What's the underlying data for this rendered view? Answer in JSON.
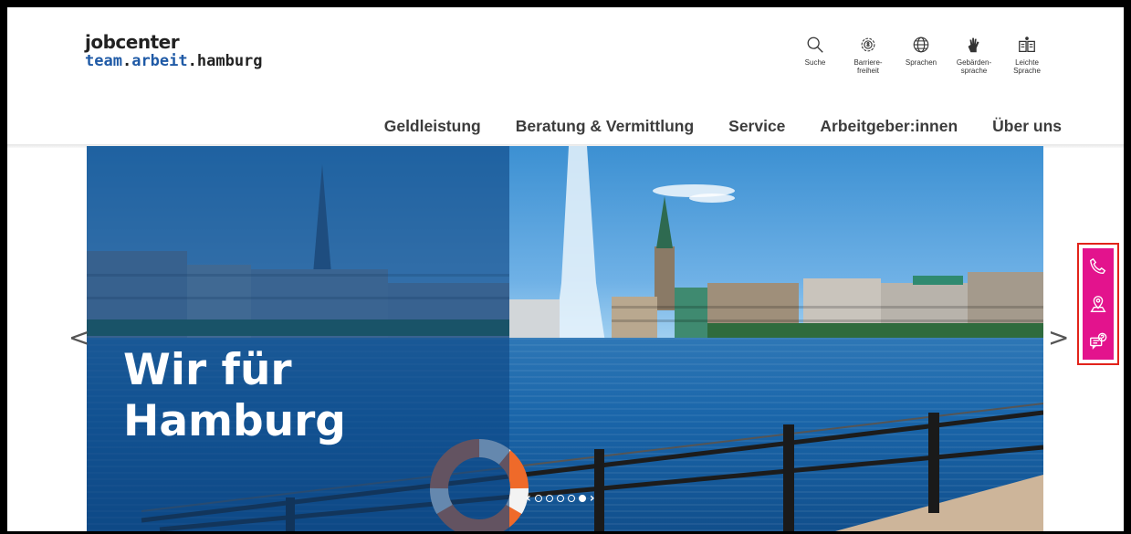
{
  "logo": {
    "line1": "jobcenter",
    "team": "team",
    "dot1": ".",
    "arbeit": "arbeit",
    "dot2": ".",
    "hamburg": "hamburg"
  },
  "tools": [
    {
      "icon": "search-icon",
      "label": "Suche"
    },
    {
      "icon": "accessibility-gear-icon",
      "label": "Barriere-\nfreiheit"
    },
    {
      "icon": "globe-icon",
      "label": "Sprachen"
    },
    {
      "icon": "sign-language-hand-icon",
      "label": "Gebärden-\nsprache"
    },
    {
      "icon": "easy-language-book-icon",
      "label": "Leichte\nSprache"
    }
  ],
  "nav": [
    "Geldleistung",
    "Beratung & Vermittlung",
    "Service",
    "Arbeitgeber:innen",
    "Über uns"
  ],
  "hero": {
    "line1": "Wir für",
    "line2": "Hamburg",
    "slides": 6,
    "active_slide": 5,
    "prev_arrow": "<",
    "next_arrow": ">",
    "slider_prev": "‹",
    "slider_next": "›"
  },
  "side_panel": {
    "icons": [
      "phone-icon",
      "location-icon",
      "chat-question-icon"
    ],
    "accent": "#e3138d",
    "highlight": "#e2231a"
  },
  "colors": {
    "brand_blue": "#1f5aa6",
    "nav_text": "#3c3c3c"
  }
}
